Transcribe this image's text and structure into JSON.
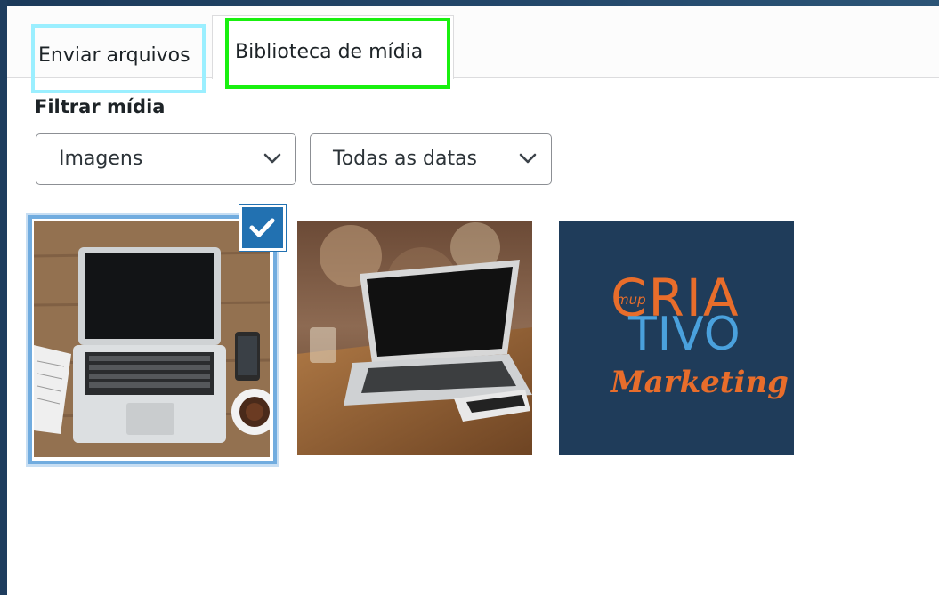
{
  "tabs": [
    {
      "label": "Enviar arquivos",
      "active": false
    },
    {
      "label": "Biblioteca de mídia",
      "active": true
    }
  ],
  "filters": {
    "label": "Filtrar mídia",
    "type_select": {
      "value": "Imagens"
    },
    "date_select": {
      "value": "Todas as datas"
    }
  },
  "attachments": [
    {
      "subject": "laptop on wooden desk top view",
      "selected": true
    },
    {
      "subject": "laptop on wooden table",
      "selected": false
    },
    {
      "subject": "Criativo Marketing logo",
      "selected": false
    }
  ],
  "logo": {
    "line1": "CRIA",
    "line2": "TIVO",
    "small": "mup",
    "line3": "Marketing"
  },
  "colors": {
    "accent": "#2271b1",
    "selected_border": "#71acdf",
    "tab_upload_highlight": "#9befff",
    "tab_library_highlight": "#19f00f",
    "logo_bg": "#1f3c5a",
    "logo_orange": "#e86d2b",
    "logo_blue": "#4aa1dd"
  }
}
